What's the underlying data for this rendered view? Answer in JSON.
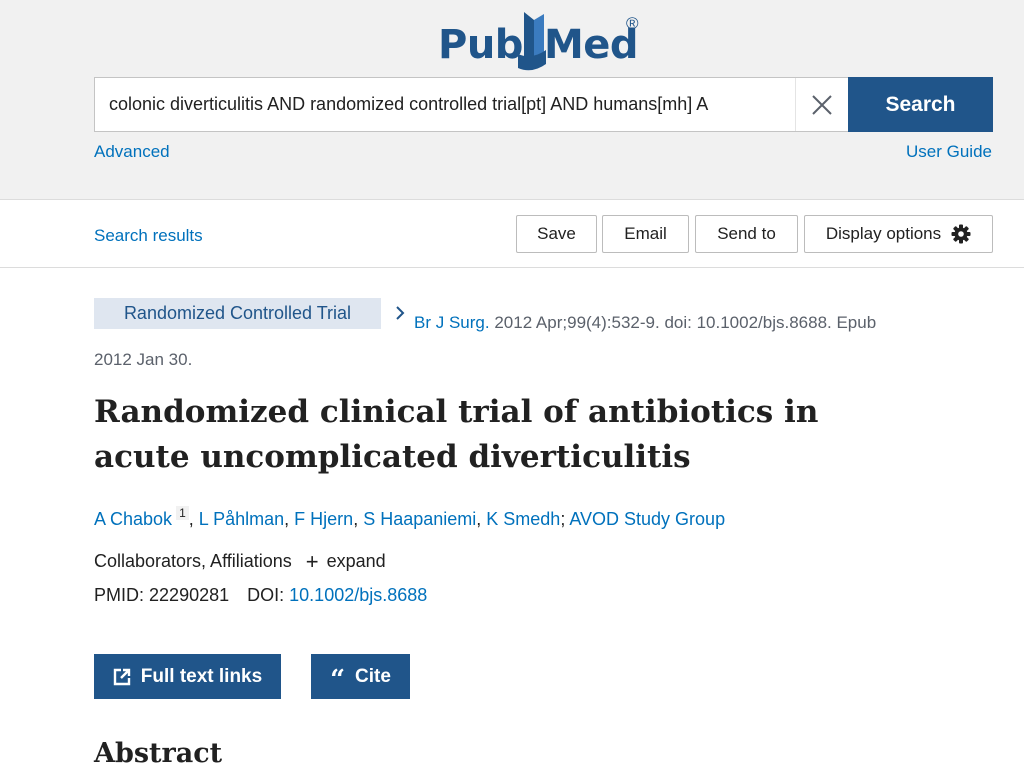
{
  "brand": {
    "name_part1": "Pub",
    "name_part2": "Med",
    "registered_mark": "®"
  },
  "search": {
    "query": "colonic diverticulitis AND randomized controlled trial[pt] AND humans[mh] A",
    "button_label": "Search",
    "clear_icon": "close-icon"
  },
  "links": {
    "advanced": "Advanced",
    "user_guide": "User Guide",
    "search_results": "Search results"
  },
  "actions": {
    "save": "Save",
    "email": "Email",
    "send_to": "Send to",
    "display_options": "Display options",
    "display_options_icon": "gear-icon"
  },
  "article": {
    "publication_type": "Randomized Controlled Trial",
    "journal": "Br J Surg.",
    "citation_rest": "2012 Apr;99(4):532-9. doi: 10.1002/bjs.8688. Epub 2012 Jan 30.",
    "title": "Randomized clinical trial of antibiotics in acute uncomplicated diverticulitis",
    "authors": [
      {
        "name": "A Chabok",
        "affiliation": "1"
      },
      {
        "name": "L Påhlman"
      },
      {
        "name": "F Hjern"
      },
      {
        "name": "S Haapaniemi"
      },
      {
        "name": "K Smedh"
      },
      {
        "name": "AVOD Study Group"
      }
    ],
    "collab_label": "Collaborators, Affiliations",
    "expand_label": "expand",
    "pmid_label": "PMID:",
    "pmid": "22290281",
    "doi_label": "DOI:",
    "doi": "10.1002/bjs.8688"
  },
  "buttons": {
    "full_text_links": "Full text links",
    "cite": "Cite"
  },
  "sections": {
    "abstract": "Abstract"
  },
  "colors": {
    "brand_blue": "#20558a",
    "link_blue": "#0071bc",
    "header_bg": "#f1f1f1",
    "pub_type_bg": "#dfe6f0"
  }
}
